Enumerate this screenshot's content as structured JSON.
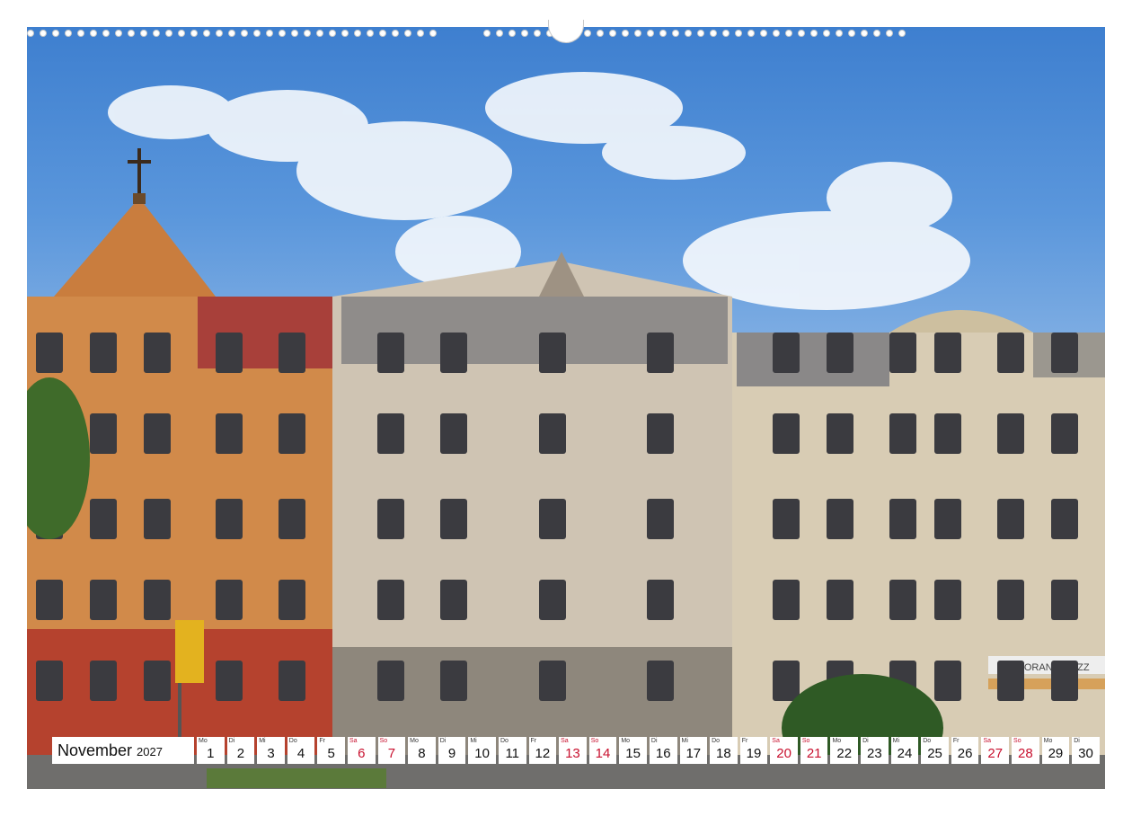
{
  "calendar": {
    "month": "November",
    "year": "2027",
    "days": [
      {
        "num": "1",
        "wd": "Mo",
        "weekend": false
      },
      {
        "num": "2",
        "wd": "Di",
        "weekend": false
      },
      {
        "num": "3",
        "wd": "Mi",
        "weekend": false
      },
      {
        "num": "4",
        "wd": "Do",
        "weekend": false
      },
      {
        "num": "5",
        "wd": "Fr",
        "weekend": false
      },
      {
        "num": "6",
        "wd": "Sa",
        "weekend": true
      },
      {
        "num": "7",
        "wd": "So",
        "weekend": true
      },
      {
        "num": "8",
        "wd": "Mo",
        "weekend": false
      },
      {
        "num": "9",
        "wd": "Di",
        "weekend": false
      },
      {
        "num": "10",
        "wd": "Mi",
        "weekend": false
      },
      {
        "num": "11",
        "wd": "Do",
        "weekend": false
      },
      {
        "num": "12",
        "wd": "Fr",
        "weekend": false
      },
      {
        "num": "13",
        "wd": "Sa",
        "weekend": true
      },
      {
        "num": "14",
        "wd": "So",
        "weekend": true
      },
      {
        "num": "15",
        "wd": "Mo",
        "weekend": false
      },
      {
        "num": "16",
        "wd": "Di",
        "weekend": false
      },
      {
        "num": "17",
        "wd": "Mi",
        "weekend": false
      },
      {
        "num": "18",
        "wd": "Do",
        "weekend": false
      },
      {
        "num": "19",
        "wd": "Fr",
        "weekend": false
      },
      {
        "num": "20",
        "wd": "Sa",
        "weekend": true
      },
      {
        "num": "21",
        "wd": "So",
        "weekend": true
      },
      {
        "num": "22",
        "wd": "Mo",
        "weekend": false
      },
      {
        "num": "23",
        "wd": "Di",
        "weekend": false
      },
      {
        "num": "24",
        "wd": "Mi",
        "weekend": false
      },
      {
        "num": "25",
        "wd": "Do",
        "weekend": false
      },
      {
        "num": "26",
        "wd": "Fr",
        "weekend": false
      },
      {
        "num": "27",
        "wd": "Sa",
        "weekend": true
      },
      {
        "num": "28",
        "wd": "So",
        "weekend": true
      },
      {
        "num": "29",
        "wd": "Mo",
        "weekend": false
      },
      {
        "num": "30",
        "wd": "Di",
        "weekend": false
      }
    ]
  },
  "photo": {
    "shop_sign": "RISTORANTE PIZZ"
  },
  "colors": {
    "weekend": "#c8102e",
    "sky": "#4a8ad6"
  }
}
